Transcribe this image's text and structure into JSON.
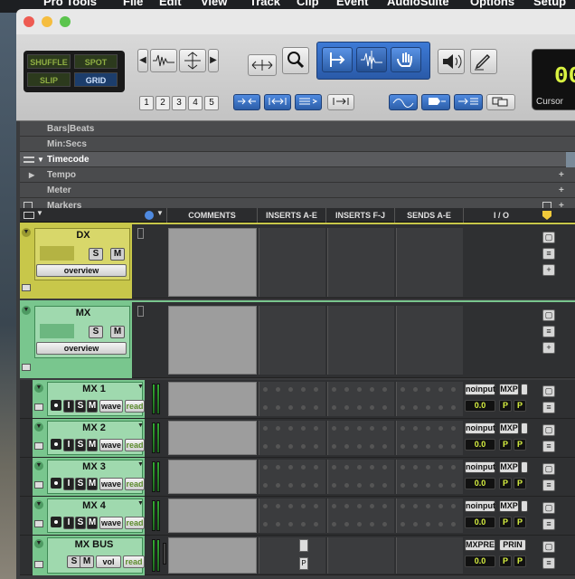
{
  "menubar": {
    "items": [
      "Pro Tools",
      "File",
      "Edit",
      "View",
      "Track",
      "Clip",
      "Event",
      "AudioSuite",
      "Options",
      "Setup"
    ]
  },
  "window": {
    "traffic_lights": [
      "#ee5b52",
      "#f5bd3f",
      "#5bc44d"
    ]
  },
  "toolbar": {
    "edit_modes": {
      "shuffle": "SHUFFLE",
      "spot": "SPOT",
      "slip": "SLIP",
      "grid": "GRID"
    },
    "zoom_presets": [
      "1",
      "2",
      "3",
      "4",
      "5"
    ],
    "counter": {
      "value": "00",
      "label": "Cursor"
    }
  },
  "rulers": {
    "rows": [
      "Bars|Beats",
      "Min:Secs",
      "Timecode",
      "Tempo",
      "Meter",
      "Markers"
    ]
  },
  "mix_header": {
    "columns": [
      "COMMENTS",
      "INSERTS A-E",
      "INSERTS F-J",
      "SENDS A-E",
      "I / O"
    ]
  },
  "folder_tracks": [
    {
      "name": "DX",
      "solo": "S",
      "mute": "M",
      "view": "overview",
      "color": "#c8c74a"
    },
    {
      "name": "MX",
      "solo": "S",
      "mute": "M",
      "view": "overview",
      "color": "#79c68e"
    }
  ],
  "audio_tracks": [
    {
      "name": "MX 1",
      "i": "I",
      "s": "S",
      "m": "M",
      "view": "wave",
      "auto": "read",
      "input": "noinput",
      "output": "MXP",
      "vol": "0.0",
      "pan1": "P",
      "pan2": "P"
    },
    {
      "name": "MX 2",
      "i": "I",
      "s": "S",
      "m": "M",
      "view": "wave",
      "auto": "read",
      "input": "noinput",
      "output": "MXP",
      "vol": "0.0",
      "pan1": "P",
      "pan2": "P"
    },
    {
      "name": "MX 3",
      "i": "I",
      "s": "S",
      "m": "M",
      "view": "wave",
      "auto": "read",
      "input": "noinput",
      "output": "MXP",
      "vol": "0.0",
      "pan1": "P",
      "pan2": "P"
    },
    {
      "name": "MX 4",
      "i": "I",
      "s": "S",
      "m": "M",
      "view": "wave",
      "auto": "read",
      "input": "noinput",
      "output": "MXP",
      "vol": "0.0",
      "pan1": "P",
      "pan2": "P"
    }
  ],
  "aux_track": {
    "name": "MX BUS",
    "s": "S",
    "m": "M",
    "view": "vol",
    "auto": "read",
    "input": "MXPRE",
    "output": "PRIN",
    "vol": "0.0",
    "pan1": "P",
    "pan2": "P",
    "insert_label": "P"
  }
}
